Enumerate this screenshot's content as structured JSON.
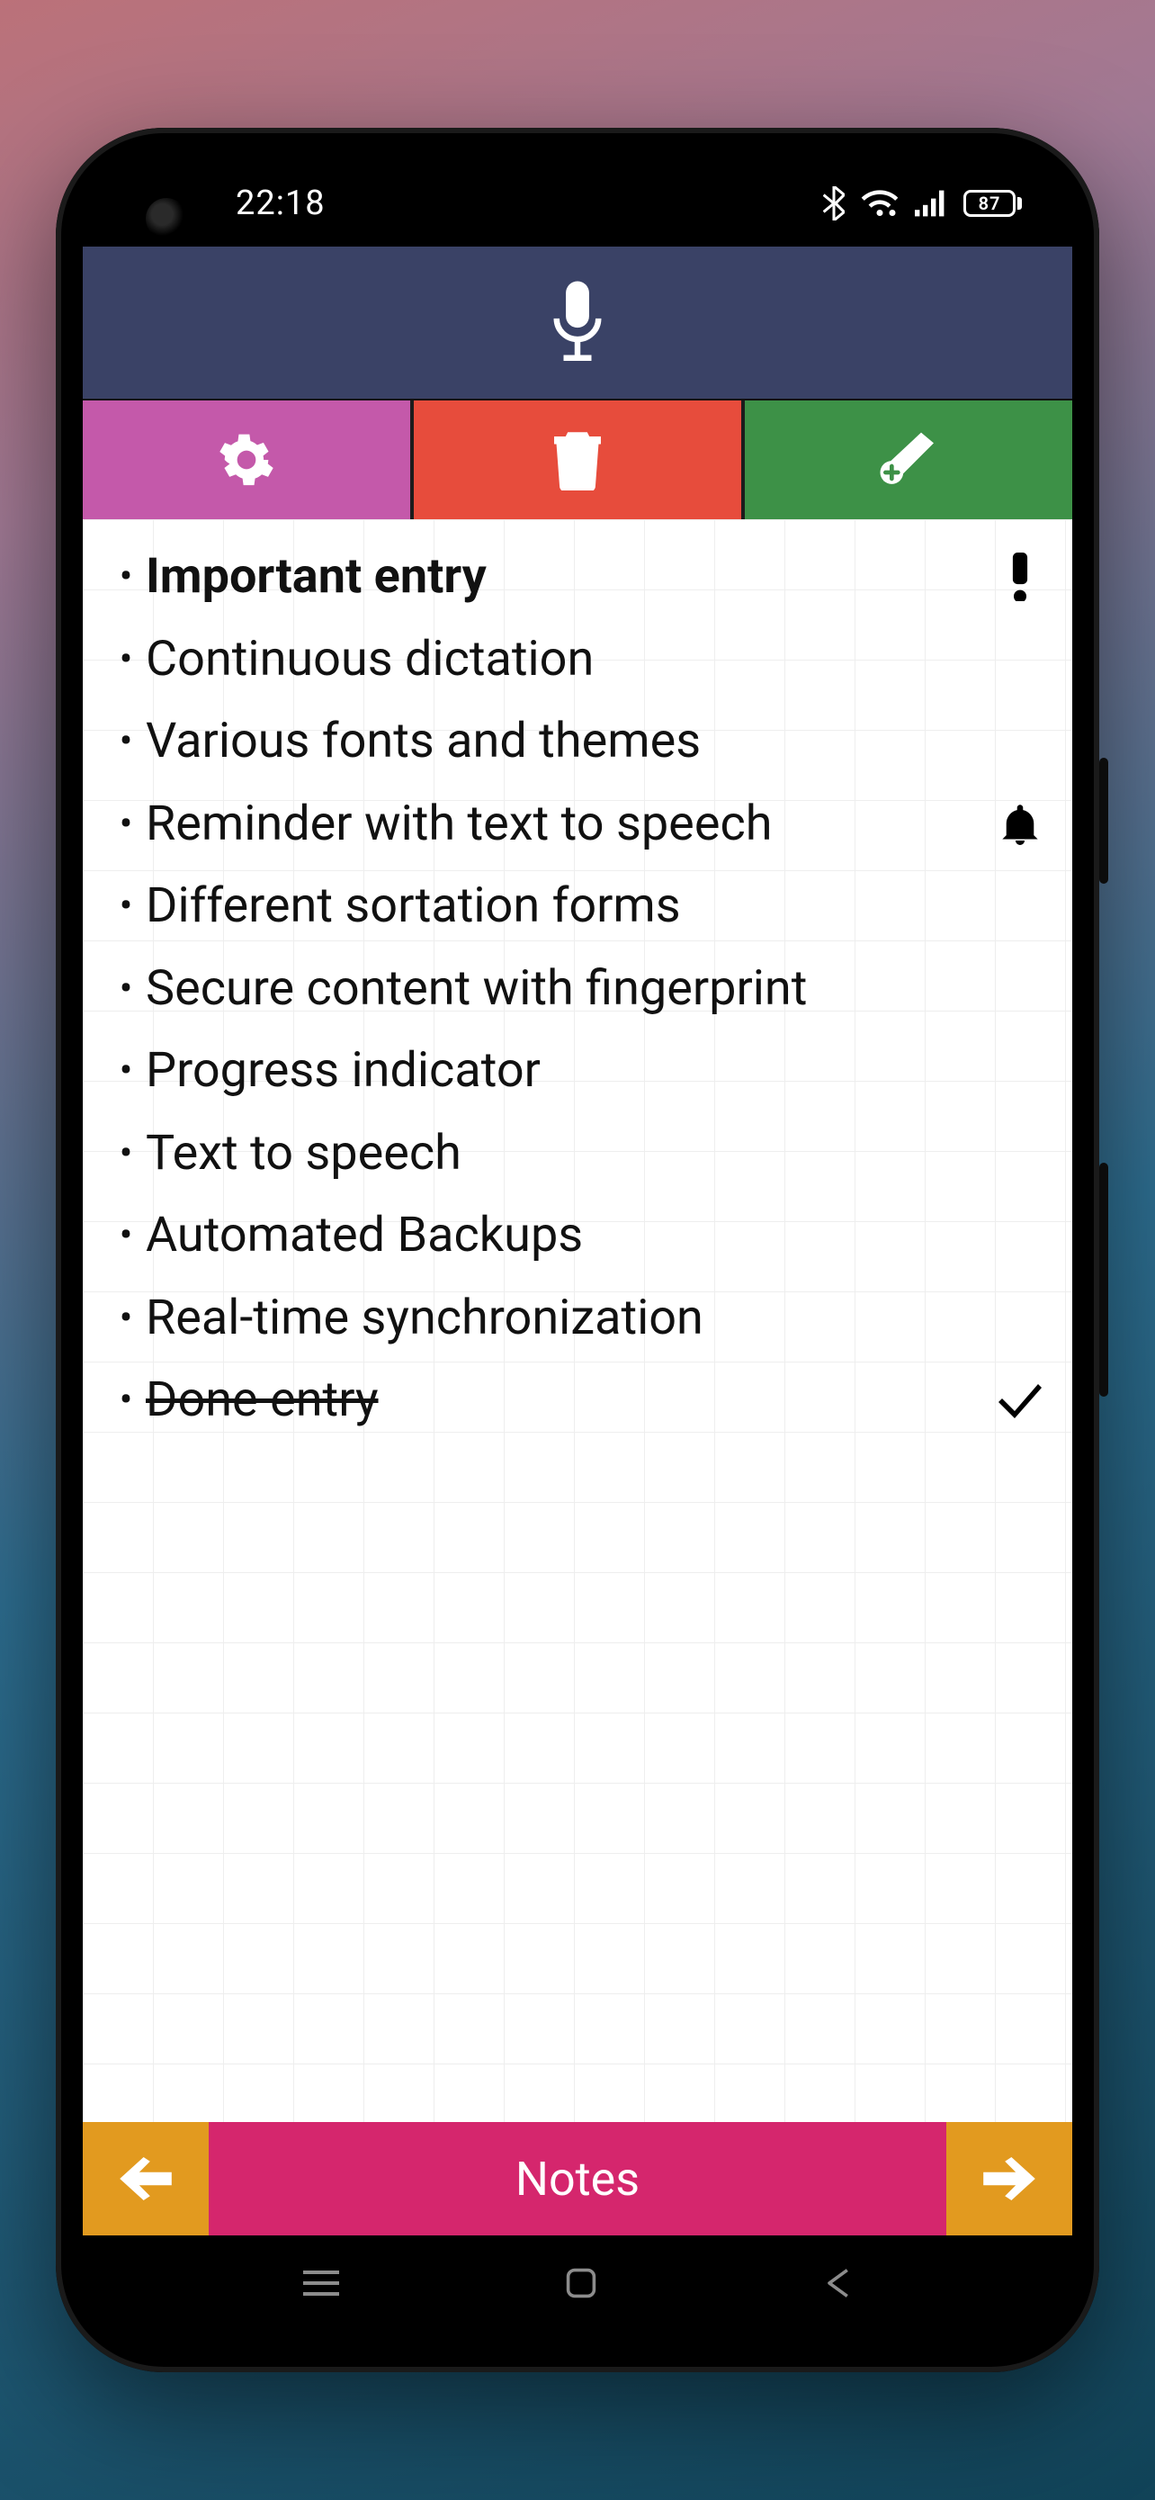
{
  "statusbar": {
    "time": "22:18",
    "battery": "87"
  },
  "entries": [
    {
      "text": "Important entry",
      "style": "important",
      "badge": "important"
    },
    {
      "text": "Continuous dictation",
      "style": "normal",
      "badge": ""
    },
    {
      "text": "Various fonts and themes",
      "style": "normal",
      "badge": ""
    },
    {
      "text": "Reminder with text to speech",
      "style": "normal",
      "badge": "reminder"
    },
    {
      "text": "Different sortation forms",
      "style": "normal",
      "badge": ""
    },
    {
      "text": "Secure content with fingerprint",
      "style": "normal",
      "badge": ""
    },
    {
      "text": "Progress indicator",
      "style": "normal",
      "badge": ""
    },
    {
      "text": "Text to speech",
      "style": "normal",
      "badge": ""
    },
    {
      "text": "Automated Backups",
      "style": "normal",
      "badge": ""
    },
    {
      "text": "Real-time synchronization",
      "style": "normal",
      "badge": ""
    },
    {
      "text": "Done entry",
      "style": "done",
      "badge": "done"
    }
  ],
  "footer": {
    "title": "Notes"
  }
}
